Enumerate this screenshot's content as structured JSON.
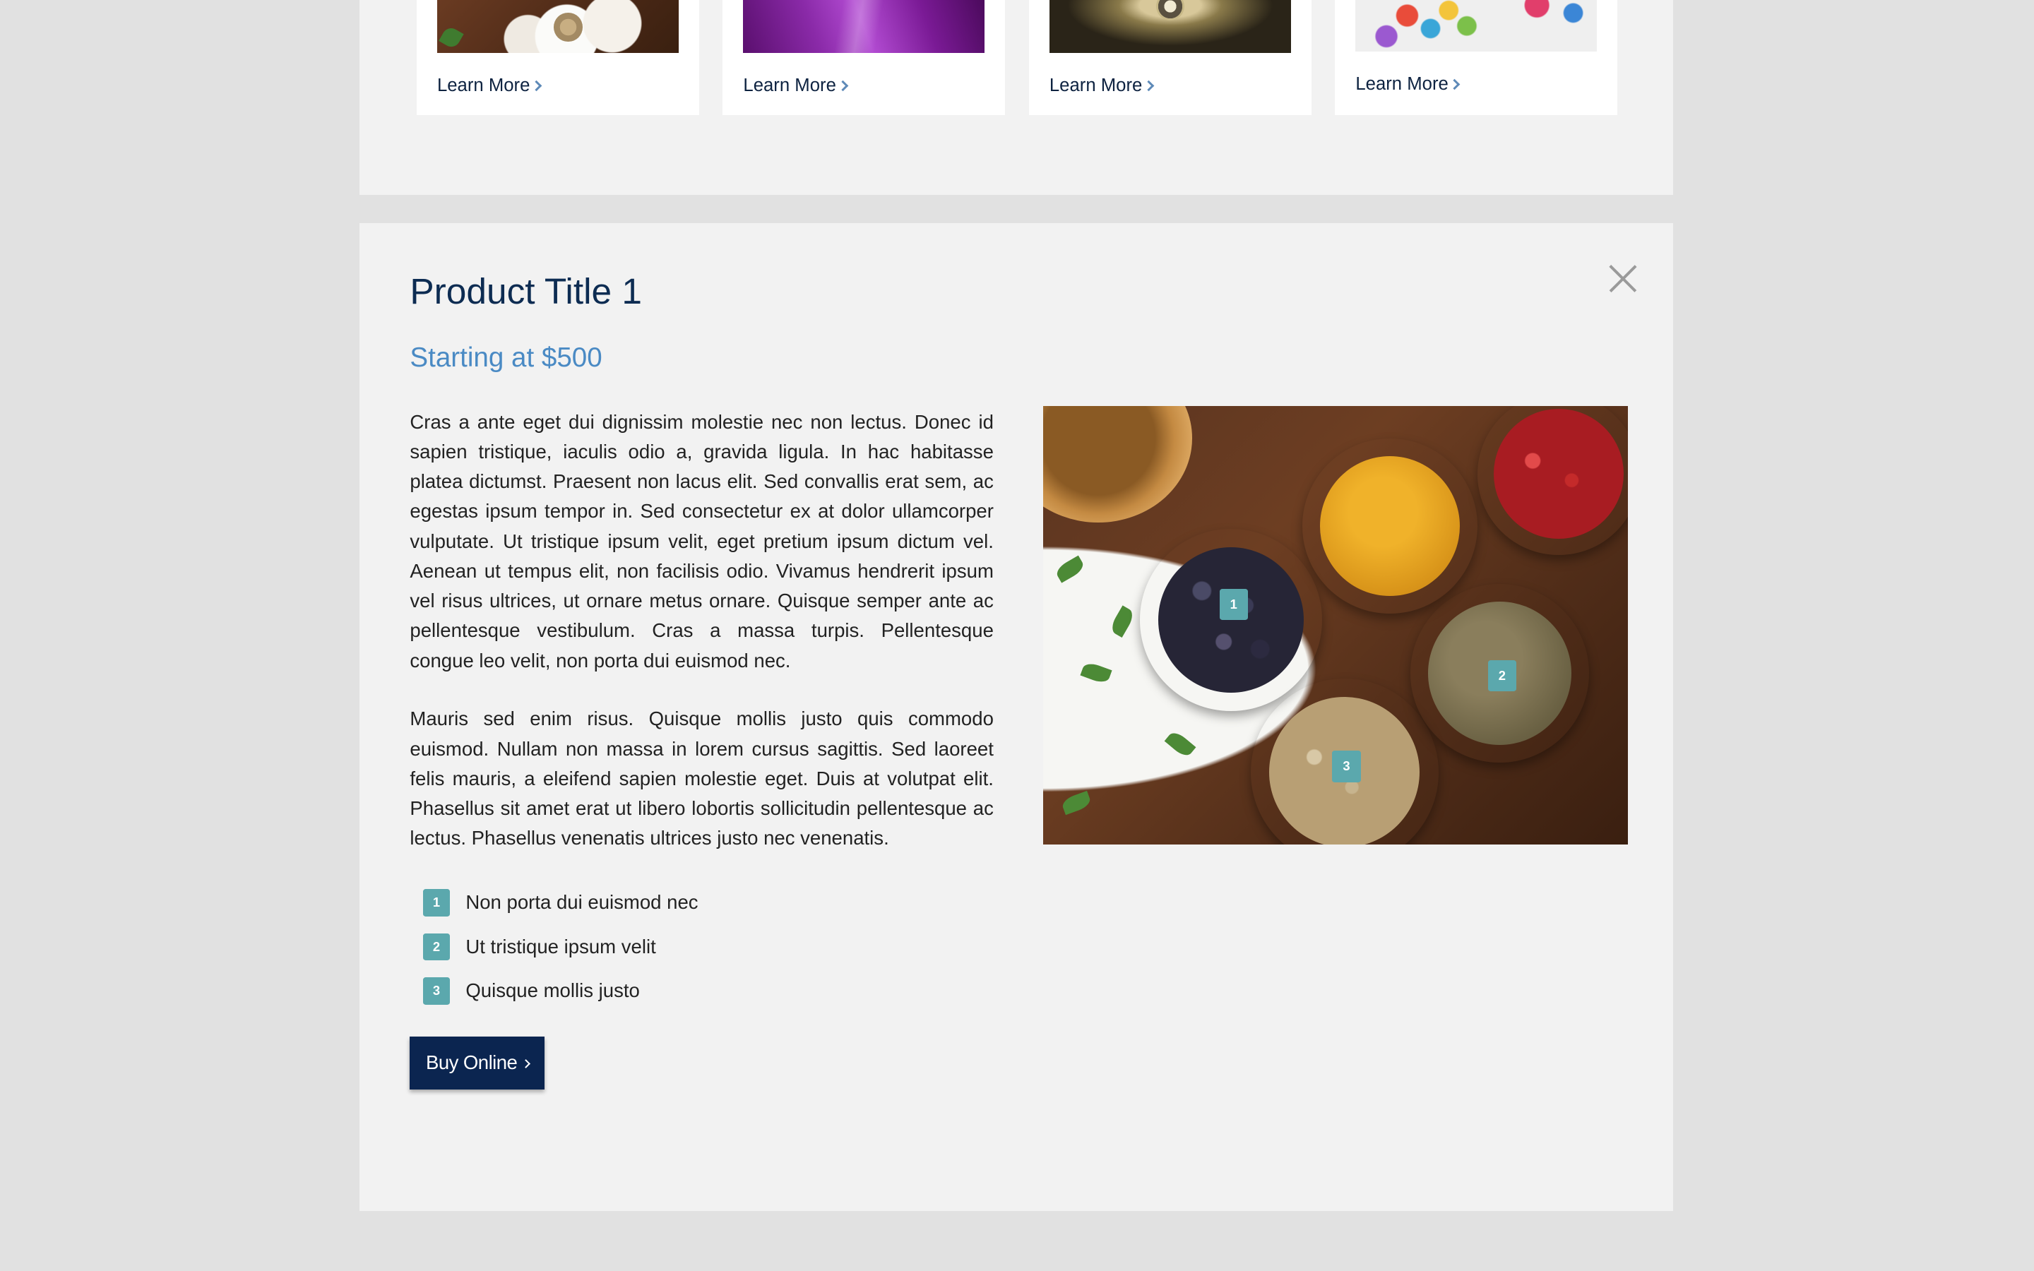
{
  "product_grid": {
    "cards": [
      {
        "link_label": "Learn More"
      },
      {
        "link_label": "Learn More"
      },
      {
        "link_label": "Learn More"
      },
      {
        "link_label": "Learn More"
      }
    ]
  },
  "product_detail": {
    "title": "Product Title 1",
    "price": "Starting at $500",
    "paragraphs": [
      "Cras a ante eget dui dignissim molestie nec non lectus. Donec id sapien tristique, iaculis odio a, gravida ligula. In hac habitasse platea dictumst. Praesent non lacus elit. Sed convallis erat sem, ac egestas ipsum tempor in. Sed consectetur ex at dolor ullamcorper vulputate. Ut tristique ipsum velit, eget pretium ipsum dictum vel. Aenean ut tempus elit, non facilisis odio. Vivamus hendrerit ipsum vel risus ultrices, ut ornare metus ornare. Quisque semper ante ac pellentesque vestibulum. Cras a massa turpis. Pellentesque congue leo velit, non porta dui euismod nec.",
      "Mauris sed enim risus. Quisque mollis justo quis commodo euismod. Nullam non massa in lorem cursus sagittis. Sed laoreet felis mauris, a eleifend sapien molestie eget. Duis at volutpat elit. Phasellus sit amet erat ut libero lobortis sollicitudin pellentesque ac lectus. Phasellus venenatis ultrices justo nec venenatis."
    ],
    "features": [
      {
        "number": "1",
        "label": "Non porta dui euismod nec"
      },
      {
        "number": "2",
        "label": "Ut tristique ipsum velit"
      },
      {
        "number": "3",
        "label": "Quisque mollis justo"
      }
    ],
    "buy_button_label": "Buy Online",
    "image_markers": [
      "1",
      "2",
      "3"
    ]
  },
  "colors": {
    "page_background": "#e1e1e1",
    "panel_background": "#f2f2f2",
    "title": "#0d2c52",
    "price": "#4a8ac4",
    "badge": "#5ba8ad",
    "buy_button": "#0b2550"
  },
  "icons": {
    "close": "close-icon",
    "link_chevron": "chevron-right-icon"
  }
}
